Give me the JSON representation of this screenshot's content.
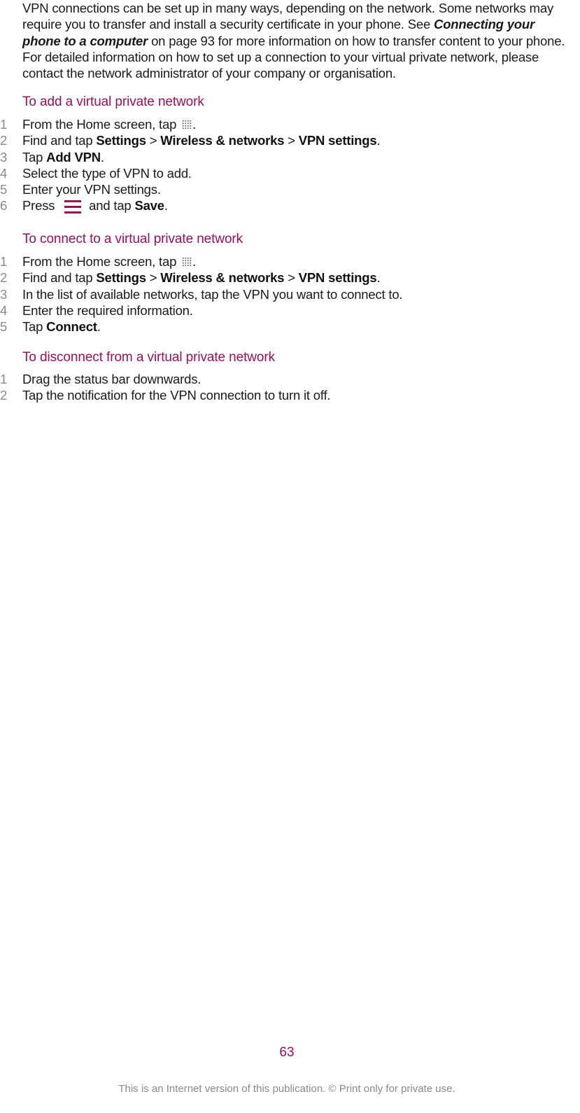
{
  "intro": {
    "text_before": "VPN connections can be set up in many ways, depending on the network. Some networks may require you to transfer and install a security certificate in your phone. See ",
    "link": "Connecting your phone to a computer",
    "text_after": " on page 93 for more information on how to transfer content to your phone. For detailed information on how to set up a connection to your virtual private network, please contact the network administrator of your company or organisation."
  },
  "sections": [
    {
      "heading": "To add a virtual private network",
      "steps": [
        {
          "n": "1",
          "a": "From the Home screen, tap ",
          "icon": "grid-icon",
          "b": "."
        },
        {
          "n": "2",
          "a": "Find and tap ",
          "b1": "Settings",
          "s1": " > ",
          "b2": "Wireless & networks",
          "s2": " > ",
          "b3": "VPN settings",
          "end": "."
        },
        {
          "n": "3",
          "a": "Tap ",
          "b1": "Add VPN",
          "end": "."
        },
        {
          "n": "4",
          "a": "Select the type of VPN to add."
        },
        {
          "n": "5",
          "a": "Enter your VPN settings."
        },
        {
          "n": "6",
          "a": "Press ",
          "icon": "menu-icon",
          "mid": " and tap ",
          "b1": "Save",
          "end": "."
        }
      ]
    },
    {
      "heading": "To connect to a virtual private network",
      "steps": [
        {
          "n": "1",
          "a": "From the Home screen, tap ",
          "icon": "grid-icon",
          "b": "."
        },
        {
          "n": "2",
          "a": "Find and tap ",
          "b1": "Settings",
          "s1": " > ",
          "b2": "Wireless & networks",
          "s2": " > ",
          "b3": "VPN settings",
          "end": "."
        },
        {
          "n": "3",
          "a": "In the list of available networks, tap the VPN you want to connect to."
        },
        {
          "n": "4",
          "a": "Enter the required information."
        },
        {
          "n": "5",
          "a": "Tap ",
          "b1": "Connect",
          "end": "."
        }
      ]
    },
    {
      "heading": "To disconnect from a virtual private network",
      "steps": [
        {
          "n": "1",
          "a": "Drag the status bar downwards."
        },
        {
          "n": "2",
          "a": "Tap the notification for the VPN connection to turn it off."
        }
      ]
    }
  ],
  "page_number": "63",
  "footer": "This is an Internet version of this publication. © Print only for private use."
}
